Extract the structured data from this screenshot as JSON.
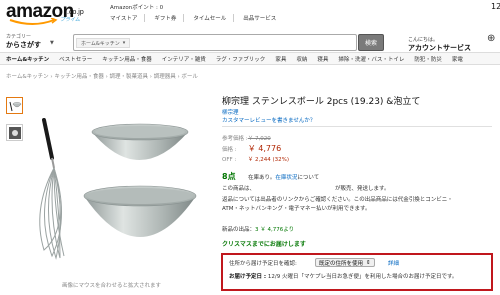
{
  "header": {
    "logo_text": "amazon",
    "logo_suffix": ".co.jp",
    "logo_prime": "プライム",
    "top_note": "Amazonポイント : 0",
    "top_links": [
      "マイストア",
      "ギフト券",
      "タイムセール",
      "出品サービス"
    ],
    "corner_number": "12",
    "category_label": "カテゴリー",
    "category_name": "からさがす",
    "search_category": "ホーム&キッチン",
    "search_button": "検索",
    "account_greeting": "こんにちは。",
    "account_label": "アカウントサービス"
  },
  "nav": {
    "home": "ホーム&キッチン",
    "items": [
      "ベストセラー",
      "キッチン用品・食器",
      "インテリア・雑貨",
      "ラグ・ファブリック",
      "家具",
      "収納",
      "寝具",
      "掃除・洗濯・バス・トイレ",
      "防犯・防災",
      "家電"
    ]
  },
  "breadcrumb": "ホーム&キッチン › キッチン用品・食器 › 調理・製菓道具 › 調理器具 › ボール",
  "image_caption": "画像にマウスを合わせると拡大されます",
  "product": {
    "title": "柳宗理 ステンレスボール 2pcs (19.23) &泡立て",
    "brand": "柳宗理",
    "review_link": "カスタマーレビューを書きませんか？",
    "list_price_label": "参考価格 :",
    "list_price": "￥ 7,020",
    "price_label": "価格 :",
    "price": "￥ 4,776",
    "off_label": "OFF :",
    "savings": "￥ 2,244 (32%)",
    "stock_main": "8点",
    "stock_rest_a": "在庫あり。",
    "stock_link": "在庫状況",
    "stock_rest_b": "について",
    "line1_a": "この商品は、",
    "line1_b": "が販売、発送します。",
    "line2": "返品については出品者のリンクからご確認ください。この出品商品には代金引換とコンビニ・",
    "line3": "ATM・ネットバンキング・電子マネー払いが利用できます。",
    "new_items_label": "新品の出品：",
    "new_items_link": "3 ￥ 4,776より",
    "xmas": "クリスマスまでにお届けします"
  },
  "delivery": {
    "label": "住所から届け予定日を確認:",
    "select_value": "既定の住所を使用",
    "detail_link": "詳細",
    "date_label": "お届け予定日 :",
    "date_text": "12/9 火曜日「マケプレ当日お急ぎ便」を利用した場合のお届け予定日です。",
    "continuation": "す。"
  }
}
